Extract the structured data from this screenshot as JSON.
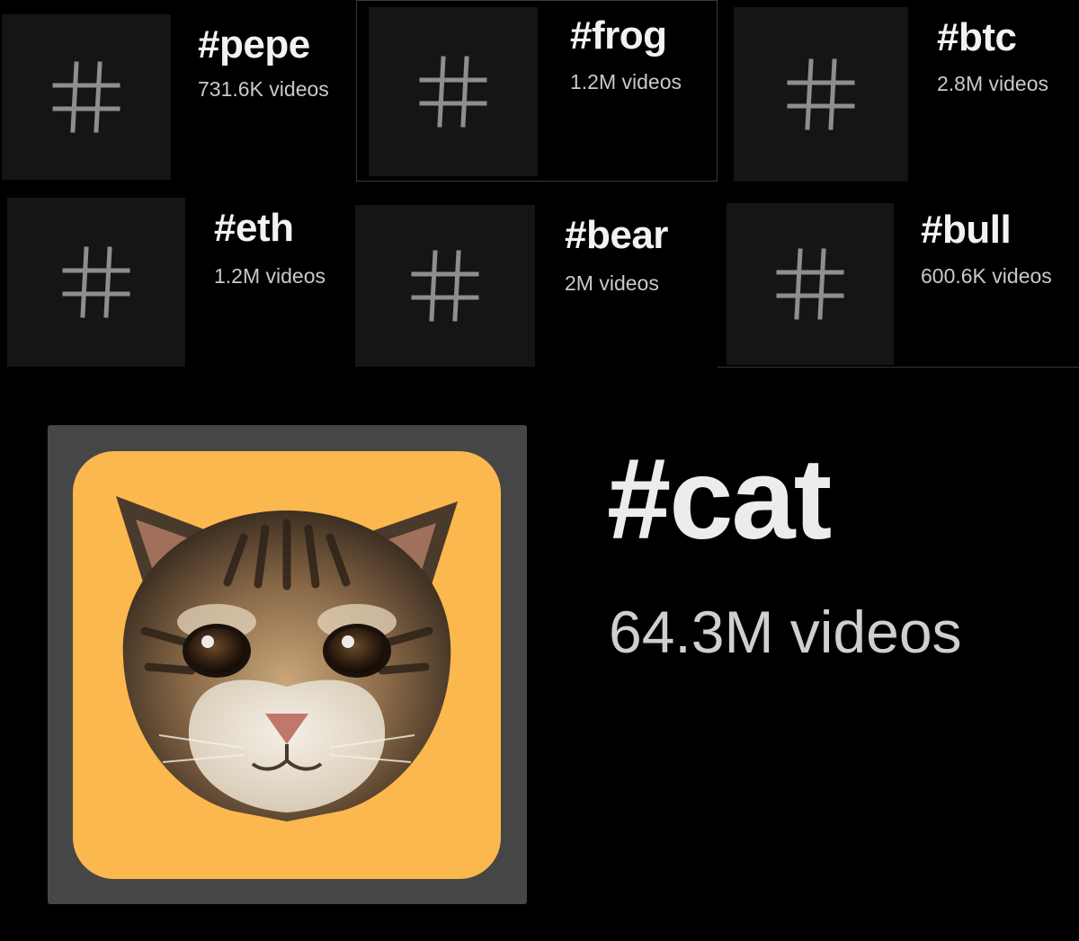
{
  "hashtags": [
    {
      "name": "#pepe",
      "count": "731.6K videos"
    },
    {
      "name": "#frog",
      "count": "1.2M videos"
    },
    {
      "name": "#btc",
      "count": "2.8M videos"
    },
    {
      "name": "#eth",
      "count": "1.2M videos"
    },
    {
      "name": "#bear",
      "count": "2M videos"
    },
    {
      "name": "#bull",
      "count": "600.6K videos"
    }
  ],
  "featured": {
    "name": "#cat",
    "count": "64.3M videos",
    "image": "kitten-face",
    "card_color": "#fbb84e"
  },
  "icon": "hashtag-icon"
}
